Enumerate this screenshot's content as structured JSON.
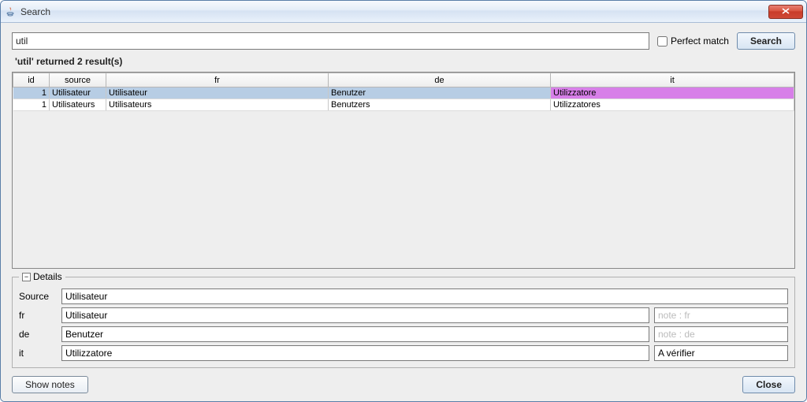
{
  "window": {
    "title": "Search"
  },
  "search": {
    "value": "util",
    "perfect_match_label": "Perfect match",
    "perfect_match_checked": false,
    "button_label": "Search"
  },
  "results": {
    "summary": "'util' returned 2 result(s)",
    "columns": [
      "id",
      "source",
      "fr",
      "de",
      "it"
    ],
    "rows": [
      {
        "id": "1",
        "source": "Utilisateur",
        "fr": "Utilisateur",
        "de": "Benutzer",
        "it": "Utilizzatore",
        "selected": true,
        "highlight_col": "it"
      },
      {
        "id": "1",
        "source": "Utilisateurs",
        "fr": "Utilisateurs",
        "de": "Benutzers",
        "it": "Utilizzatores",
        "selected": false
      }
    ]
  },
  "details": {
    "title": "Details",
    "labels": {
      "source": "Source",
      "fr": "fr",
      "de": "de",
      "it": "it"
    },
    "source_value": "Utilisateur",
    "fr_value": "Utilisateur",
    "fr_note": "",
    "fr_note_placeholder": "note : fr",
    "de_value": "Benutzer",
    "de_note": "",
    "de_note_placeholder": "note : de",
    "it_value": "Utilizzatore",
    "it_note": "A vérifier"
  },
  "buttons": {
    "show_notes": "Show notes",
    "close": "Close"
  },
  "colors": {
    "selected_row": "#b7cde4",
    "highlight_cell": "#d77fe8"
  }
}
